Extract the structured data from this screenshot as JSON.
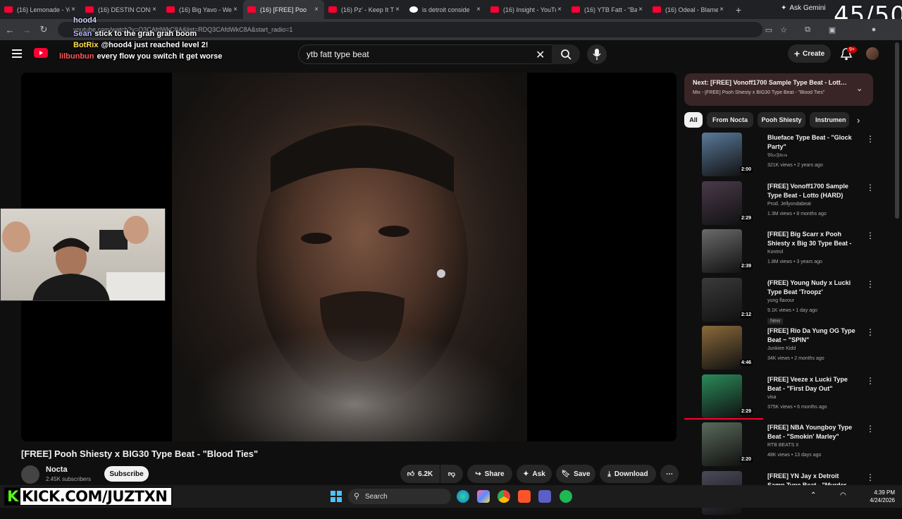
{
  "browser": {
    "tabs": [
      {
        "title": "(16) Lemonade - Yo",
        "icon": "youtube-icon",
        "active": false
      },
      {
        "title": "(16) DESTIN CONR",
        "icon": "youtube-icon",
        "active": false
      },
      {
        "title": "(16) Big Yavo - Wel",
        "icon": "youtube-icon",
        "active": false
      },
      {
        "title": "(16) [FREE] Poo",
        "icon": "youtube-icon",
        "active": true
      },
      {
        "title": "(16) Pz' - Keep It Tr",
        "icon": "youtube-icon",
        "active": false
      },
      {
        "title": "is detroit conside",
        "icon": "google-icon",
        "active": false
      },
      {
        "title": "(16) Insight - YouTu",
        "icon": "youtube-icon",
        "active": false
      },
      {
        "title": "(16) YTB Fatt - \"Ba",
        "icon": "youtube-icon",
        "active": false
      },
      {
        "title": "(16) Odeal - Blame",
        "icon": "youtube-icon",
        "active": false
      }
    ],
    "new_tab": "+",
    "ask_gemini": "Ask Gemini",
    "url": "youtube.com/watch?v=Q3CAfdWkC8A&list=RDQ3CAfdWkC8A&start_radio=1"
  },
  "overlay": {
    "counter": "45/50",
    "chat": [
      {
        "user": "hood4",
        "text": "",
        "user_color": "#d6d6ff"
      },
      {
        "user": "Sean",
        "text": "stick to the grah grah boom",
        "user_color": "#b6b6ff"
      },
      {
        "user": "BotRix",
        "text": "@hood4 just reached level 2!",
        "user_color": "#ffe14d"
      },
      {
        "user": "lilbunbun",
        "text": "every flow you switch it get worse",
        "user_color": "#ff5a5a"
      }
    ],
    "kick_banner": "KICK.COM/JUZTXN"
  },
  "youtube": {
    "search_value": "ytb fatt type beat",
    "create_label": "Create",
    "notif_count": "9+",
    "video": {
      "title": "[FREE] Pooh Shiesty x BIG30 Type Beat - \"Blood Ties\"",
      "channel": "Nocta",
      "subscribers": "2.45K subscribers",
      "subscribe_label": "Subscribe",
      "likes": "6.2K",
      "share": "Share",
      "ask": "Ask",
      "save": "Save",
      "download": "Download"
    },
    "up_next": {
      "title": "Next: [FREE] Vonoff1700 Sample Type Beat - Lotto (...",
      "subtitle": "Mix - [FREE] Pooh Shiesty x BIG30 Type Beat - \"Blood Ties\""
    },
    "chips": [
      "All",
      "From Nocta",
      "Pooh Shiesty",
      "Instrumen"
    ],
    "recommendations": [
      {
        "title": "Blueface Type Beat - \"Glock Party\"",
        "channel": "𝔅𝔩𝔲𝔢𝔉𝔞𝔠𝔢𝔰",
        "meta": "321K views • 2 years ago",
        "duration": "2:00",
        "badge": "",
        "thumb": "#5a7a9a"
      },
      {
        "title": "[FREE] Vonoff1700 Sample Type Beat - Lotto  (HARD)",
        "channel": "Prod. Jellyondabeat",
        "meta": "1.3M views • 8 months ago",
        "duration": "2:29",
        "badge": "",
        "thumb": "#4a3a4a"
      },
      {
        "title": "[FREE] Big Scarr x Pooh Shiesty x Big 30 Type Beat - \"Murda ...",
        "channel": "Kontrol",
        "meta": "1.8M views • 3 years ago",
        "duration": "2:39",
        "badge": "",
        "thumb": "#6a6a6a"
      },
      {
        "title": "(FREE) Young Nudy x Lucki Type Beat 'Troopz'",
        "channel": "yung flavour",
        "meta": "9.1K views • 1 day ago",
        "duration": "2:12",
        "badge": "New",
        "thumb": "#3a3a3a"
      },
      {
        "title": "[FREE] Rio Da Yung OG Type Beat ~ \"SPIN\"",
        "channel": "Junkiee Kidd",
        "meta": "34K views • 2 months ago",
        "duration": "4:46",
        "badge": "",
        "thumb": "#8a6a3a"
      },
      {
        "title": "[FREE] Veeze x Lucki Type Beat - \"First Day Out\"",
        "channel": "visa",
        "meta": "375K views • 6 months ago",
        "duration": "2:29",
        "badge": "",
        "thumb": "#2a8a5a"
      },
      {
        "title": "[FREE] NBA Youngboy Type Beat - \"Smokin' Marley\"",
        "channel": "RTB BEATS II",
        "meta": "48K views • 13 days ago",
        "duration": "2:20",
        "badge": "",
        "thumb": "#5a6a5a"
      },
      {
        "title": "[FREE] YN Jay x Detroit Samp Type Beat - \"Murder She Wro...",
        "channel": "",
        "meta": "",
        "duration": "",
        "badge": "",
        "thumb": "#4a4a5a"
      }
    ]
  },
  "taskbar": {
    "search_label": "Search",
    "time": "4:39 PM",
    "date": "4/24/2026"
  }
}
